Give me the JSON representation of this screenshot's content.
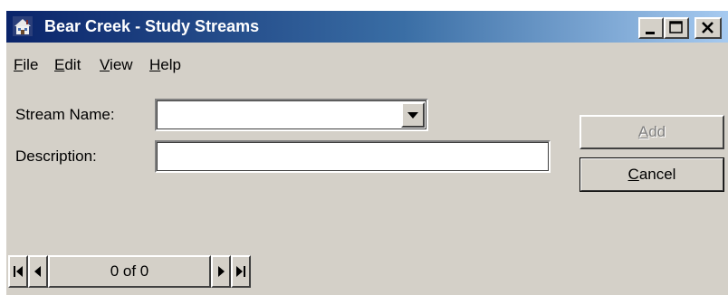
{
  "window": {
    "title": "Bear Creek - Study Streams",
    "app_icon": "house-icon",
    "controls": {
      "minimize_icon": "minimize-icon",
      "maximize_icon": "maximize-icon",
      "close_icon": "close-icon"
    }
  },
  "menu": {
    "items": [
      {
        "label_u": "F",
        "label_rest": "ile"
      },
      {
        "label_u": "E",
        "label_rest": "dit"
      },
      {
        "label_u": "V",
        "label_rest": "iew"
      },
      {
        "label_u": "H",
        "label_rest": "elp"
      }
    ]
  },
  "form": {
    "stream_name_label": "Stream Name:",
    "stream_name_value": "",
    "description_label": "Description:",
    "description_value": ""
  },
  "buttons": {
    "add_u": "A",
    "add_rest": "dd",
    "add_enabled": false,
    "cancel_u": "C",
    "cancel_rest": "ancel"
  },
  "navigator": {
    "record_text": "0 of 0",
    "first_icon": "first-record-icon",
    "prev_icon": "previous-record-icon",
    "next_icon": "next-record-icon",
    "last_icon": "last-record-icon"
  },
  "colors": {
    "window_bg": "#d4d0c8",
    "title_gradient_start": "#0a246a",
    "title_gradient_end": "#a6caf0",
    "disabled_text": "#808080"
  }
}
